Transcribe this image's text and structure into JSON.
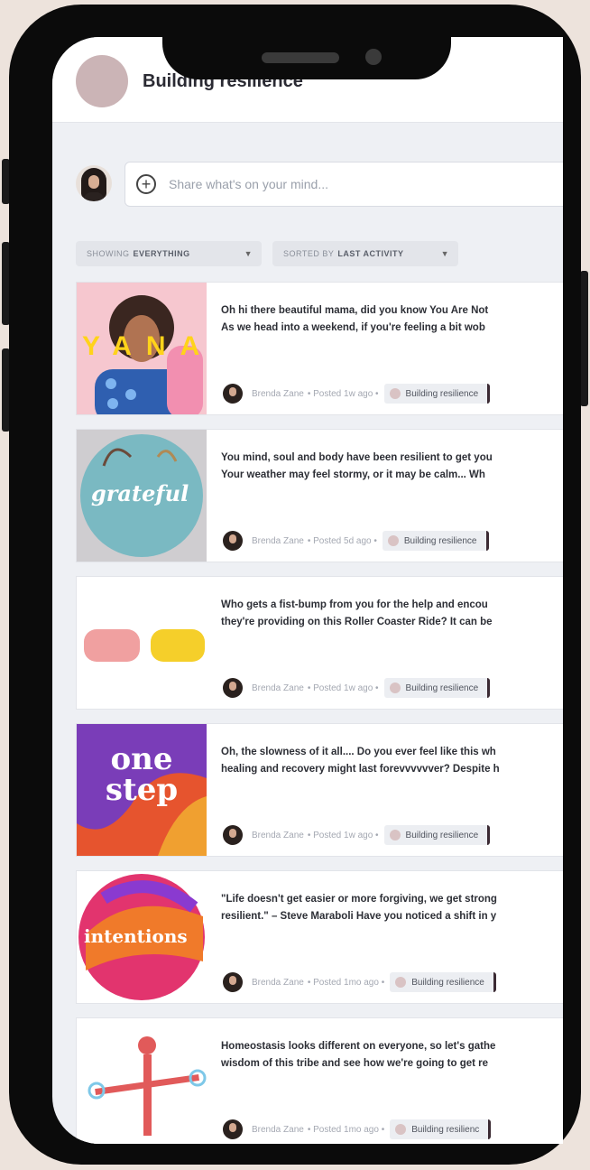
{
  "header": {
    "title": "Building resilience"
  },
  "composer": {
    "placeholder": "Share what's on your mind..."
  },
  "filters": {
    "showing_prefix": "SHOWING",
    "showing_value": "EVERYTHING",
    "sorted_prefix": "SORTED BY",
    "sorted_value": "LAST ACTIVITY"
  },
  "posts": [
    {
      "line1": "Oh hi there beautiful mama, did you know You Are Not",
      "line2": "As we head into a weekend, if you're feeling a bit wob",
      "author": "Brenda Zane",
      "posted": "• Posted 1w ago •",
      "group": "Building resilience",
      "thumb_text": "YANA"
    },
    {
      "line1": "You mind, soul and body have been resilient to get you",
      "line2": "Your weather may feel stormy, or it may be calm... Wh",
      "author": "Brenda Zane",
      "posted": "• Posted 5d ago •",
      "group": "Building resilience",
      "thumb_text": "grateful"
    },
    {
      "line1": "Who gets a fist-bump from you for the help and encou",
      "line2": "they're providing on this Roller Coaster Ride? It can be",
      "author": "Brenda Zane",
      "posted": "• Posted 1w ago •",
      "group": "Building resilience",
      "thumb_text": ""
    },
    {
      "line1": "Oh, the slowness of it all.... Do you ever feel like this wh",
      "line2": "healing and recovery might last forevvvvvver? Despite h",
      "author": "Brenda Zane",
      "posted": "• Posted 1w ago •",
      "group": "Building resilience",
      "thumb_text": "one step"
    },
    {
      "line1": "\"Life doesn't get easier or more forgiving, we get strong",
      "line2": "resilient.\" – Steve Maraboli Have you noticed a shift in y",
      "author": "Brenda Zane",
      "posted": "• Posted 1mo ago •",
      "group": "Building resilience",
      "thumb_text": "intentions"
    },
    {
      "line1": "Homeostasis looks different on everyone, so let's gathe",
      "line2": "wisdom of this tribe and see how we're going to get re",
      "author": "Brenda Zane",
      "posted": "• Posted 1mo ago •",
      "group": "Building resilienc",
      "thumb_text": ""
    }
  ]
}
